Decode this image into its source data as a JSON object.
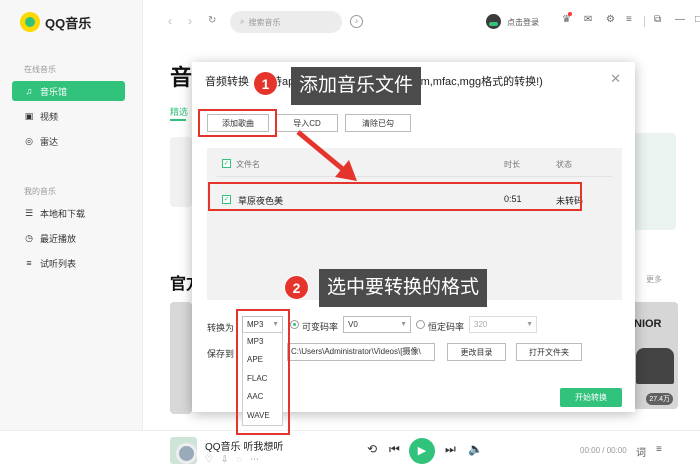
{
  "app": {
    "name": "QQ音乐"
  },
  "sidebar": {
    "online_heading": "在线音乐",
    "online_items": [
      {
        "label": "音乐馆",
        "icon": "music-note-icon",
        "active": true
      },
      {
        "label": "视频",
        "icon": "video-icon",
        "active": false
      },
      {
        "label": "雷达",
        "icon": "radar-icon",
        "active": false
      }
    ],
    "my_heading": "我的音乐",
    "my_items": [
      {
        "label": "本地和下载",
        "icon": "download-list-icon"
      },
      {
        "label": "最近播放",
        "icon": "clock-icon"
      },
      {
        "label": "试听列表",
        "icon": "playlist-icon"
      }
    ]
  },
  "topbar": {
    "search_placeholder": "搜索音乐",
    "login_label": "点击登录"
  },
  "background": {
    "page_title": "音",
    "tab_label": "精选",
    "section_title": "官方",
    "more_label": "更多",
    "photo_text": "NIOR",
    "photo_badge": "27.4万"
  },
  "dialog": {
    "title": "音频转换（支持ape,flac,mp3,wav,wma,m4a,m,mfac,mgg格式的转换!)",
    "buttons": {
      "add_song": "添加歌曲",
      "import_cd": "导入CD",
      "clear_checked": "清除已勾"
    },
    "columns": {
      "filename": "文件名",
      "duration": "时长",
      "status": "状态"
    },
    "files": [
      {
        "name": "草原夜色美",
        "duration": "0:51",
        "status": "未转码",
        "checked": true
      }
    ],
    "convert_to_label": "转换为",
    "format_selected": "MP3",
    "format_options": [
      "MP3",
      "APE",
      "FLAC",
      "AAC",
      "WAVE"
    ],
    "vbr_label": "可变码率",
    "vbr_value": "V0",
    "cbr_label": "恒定码率",
    "cbr_value": "320",
    "save_to_label": "保存到",
    "save_path": "C:\\Users\\Administrator\\Videos\\[摄像\\",
    "change_dir": "更改目录",
    "open_folder": "打开文件夹",
    "start": "开始转换"
  },
  "annotations": {
    "step1_number": "1",
    "step1_text": "添加音乐文件",
    "step2_number": "2",
    "step2_text": "选中要转换的格式"
  },
  "player": {
    "song": "QQ音乐 听我想听",
    "time": "00:00 / 00:00",
    "lyric_label": "词"
  },
  "colors": {
    "accent": "#31c27c",
    "annotation": "#e5342c",
    "callout": "#4b4b4b"
  }
}
